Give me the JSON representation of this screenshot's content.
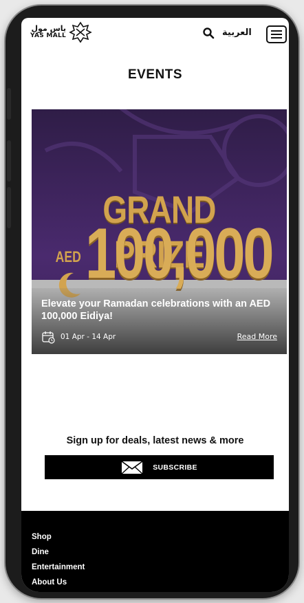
{
  "header": {
    "logo_arabic": "ياس مول",
    "logo_english": "YAS MALL",
    "language_label": "العربية"
  },
  "page": {
    "title": "EVENTS"
  },
  "event": {
    "image_headline": "GRAND PRIZE",
    "image_currency": "AED",
    "image_amount": "100,000",
    "title": "Elevate your Ramadan celebrations with an AED 100,000 Eidiya!",
    "date_range": "01 Apr - 14 Apr",
    "read_more": "Read More"
  },
  "subscribe": {
    "prompt": "Sign up for deals, latest news & more",
    "button_label": "SUBSCRIBE"
  },
  "footer": {
    "links": [
      "Shop",
      "Dine",
      "Entertainment",
      "About Us"
    ]
  },
  "icons": {
    "logo": "yas-mall-logo",
    "search": "search-icon",
    "menu": "hamburger-menu-icon",
    "calendar": "calendar-icon",
    "mail": "envelope-icon"
  },
  "colors": {
    "accent_gold": "#d2a34e",
    "event_background": "#3a2352",
    "footer_background": "#000000",
    "text": "#111111"
  }
}
